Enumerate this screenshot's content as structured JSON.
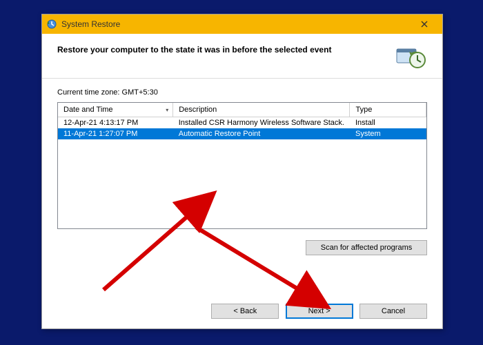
{
  "titlebar": {
    "title": "System Restore"
  },
  "header": {
    "heading": "Restore your computer to the state it was in before the selected event"
  },
  "timezone_label": "Current time zone: GMT+5:30",
  "columns": {
    "date": "Date and Time",
    "desc": "Description",
    "type": "Type"
  },
  "rows": [
    {
      "date": "12-Apr-21 4:13:17 PM",
      "desc": "Installed CSR Harmony Wireless Software Stack.",
      "type": "Install",
      "selected": false
    },
    {
      "date": "11-Apr-21 1:27:07 PM",
      "desc": "Automatic Restore Point",
      "type": "System",
      "selected": true
    }
  ],
  "buttons": {
    "scan": "Scan for affected programs",
    "back": "< Back",
    "next": "Next >",
    "cancel": "Cancel"
  }
}
